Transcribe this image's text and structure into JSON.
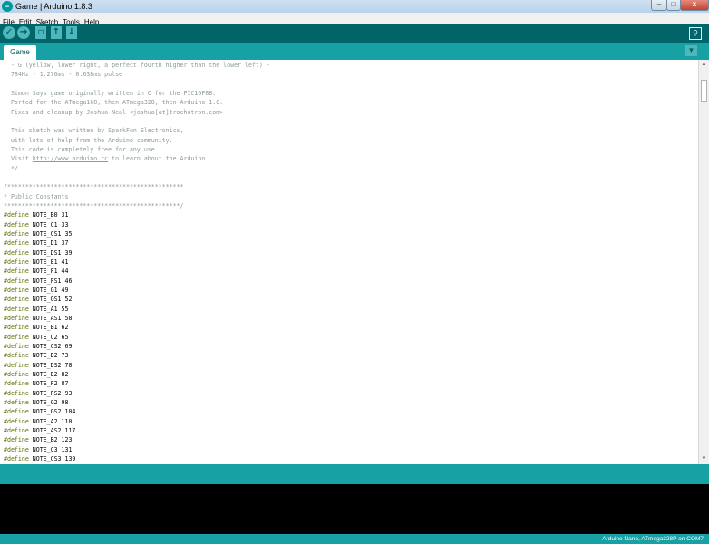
{
  "window": {
    "title": "Game | Arduino 1.8.3",
    "app_icon": "∞",
    "minimize": "–",
    "maximize": "□",
    "close": "x"
  },
  "menu": [
    "File",
    "Edit",
    "Sketch",
    "Tools",
    "Help"
  ],
  "toolbar": {
    "verify_icon": "✓",
    "upload_icon": "→",
    "new_icon": "▫",
    "open_icon": "↑",
    "save_icon": "↓",
    "serial_icon": "⚲"
  },
  "tabs": {
    "active": "Game",
    "menu_icon": "▼"
  },
  "code": {
    "header_comments": [
      "  - G (yellow, lower right, a perfect fourth higher than the lower left) -",
      "  784Hz - 1.276ms - 0.638ms pulse",
      "",
      "  Simon Says game originally written in C for the PIC16F88.",
      "  Ported for the ATmega168, then ATmega328, then Arduino 1.0.",
      "  Fixes and cleanup by Joshua Neal <joshua[at]trochotron.com>",
      "",
      "  This sketch was written by SparkFun Electronics,",
      "  with lots of help from the Arduino community.",
      "  This code is completely free for any use.",
      "  Visit ",
      "  */",
      "",
      "/*************************************************",
      "* Public Constants",
      "*************************************************/"
    ],
    "visit_url": "http://www.arduino.cc",
    "visit_tail": " to learn about the Arduino.",
    "define_keyword": "#define",
    "defines": [
      " NOTE_B0 31",
      " NOTE_C1 33",
      " NOTE_CS1 35",
      " NOTE_D1 37",
      " NOTE_DS1 39",
      " NOTE_E1 41",
      " NOTE_F1 44",
      " NOTE_FS1 46",
      " NOTE_G1 49",
      " NOTE_GS1 52",
      " NOTE_A1 55",
      " NOTE_AS1 58",
      " NOTE_B1 62",
      " NOTE_C2 65",
      " NOTE_CS2 69",
      " NOTE_D2 73",
      " NOTE_DS2 78",
      " NOTE_E2 82",
      " NOTE_F2 87",
      " NOTE_FS2 93",
      " NOTE_G2 98",
      " NOTE_GS2 104",
      " NOTE_A2 110",
      " NOTE_AS2 117",
      " NOTE_B2 123",
      " NOTE_C3 131",
      " NOTE_CS3 139"
    ]
  },
  "scrollbar": {
    "up_icon": "▲",
    "down_icon": "▼"
  },
  "status": {
    "board": "Arduino Nano, ATmega328P on COM7"
  }
}
